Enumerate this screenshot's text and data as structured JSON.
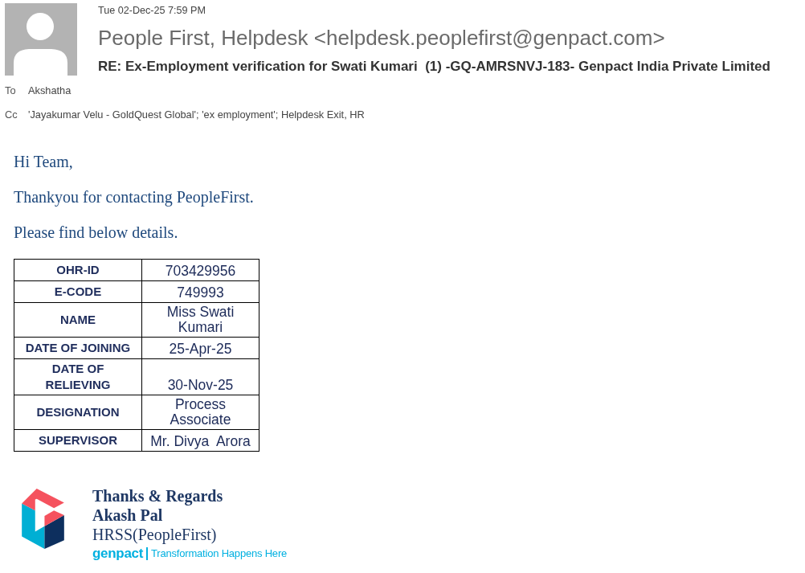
{
  "message": {
    "date": "Tue 02-Dec-25 7:59 PM",
    "sender": "People First, Helpdesk <helpdesk.peoplefirst@genpact.com>",
    "subject": "RE: Ex-Employment verification for Swati Kumari  (1) -GQ-AMRSNVJ-183- Genpact India Private Limited",
    "recipients": [
      {
        "label": "To",
        "value": "Akshatha"
      },
      {
        "label": "Cc",
        "value": "'Jayakumar Velu - GoldQuest Global'; 'ex employment'; Helpdesk Exit, HR"
      }
    ]
  },
  "body": {
    "paragraphs": [
      "Hi Team,",
      "Thankyou for contacting PeopleFirst.",
      "Please find below details."
    ],
    "table": {
      "rows": [
        {
          "field": "OHR-ID",
          "value": "703429956"
        },
        {
          "field": "E-CODE",
          "value": "749993"
        },
        {
          "field": "NAME",
          "value": "Miss Swati Kumari"
        },
        {
          "field": "DATE OF JOINING",
          "value": "25-Apr-25"
        },
        {
          "field": "DATE OF RELIEVING",
          "value": "30-Nov-25"
        },
        {
          "field": "DESIGNATION",
          "value": "Process Associate"
        },
        {
          "field": "SUPERVISOR",
          "value": "Mr. Divya  Arora"
        }
      ]
    }
  },
  "signature": {
    "closing": "Thanks & Regards",
    "name": "Akash Pal",
    "role": "HRSS(PeopleFirst)",
    "brand": "genpact",
    "tagline": "Transformation Happens Here"
  }
}
